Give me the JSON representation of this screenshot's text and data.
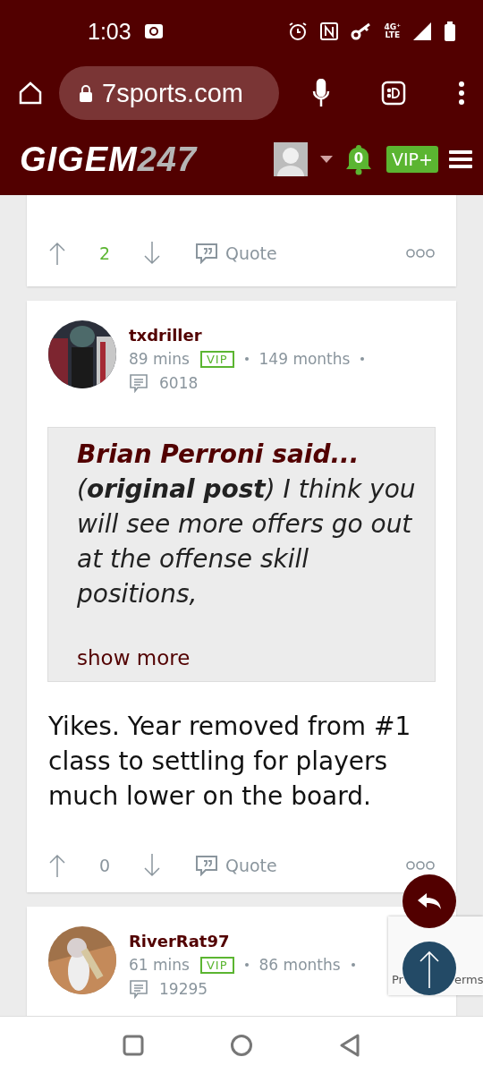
{
  "status_bar": {
    "time": "1:03",
    "network": "4G⁺\nLTE"
  },
  "browser": {
    "url": "7sports.com"
  },
  "site_header": {
    "logo": "GIGEM",
    "logo_suffix": "247",
    "notifications": "0",
    "vip_button": "VIP+"
  },
  "posts": [
    {
      "kind": "partial",
      "score": "2",
      "score_positive": true,
      "quote_label": "Quote"
    },
    {
      "kind": "full",
      "author": "txdriller",
      "age": "89 mins",
      "badge": "VIP",
      "tenure": "149 months",
      "post_count": "6018",
      "quote": {
        "author": "Brian Perroni said...",
        "text": "(**original post**) I think you will see more offers go out at the offense skill positions,",
        "more": "show more"
      },
      "body": "Yikes. Year removed from #1 class to settling for players much lower on the board.",
      "score": "0",
      "score_positive": false,
      "quote_label": "Quote"
    },
    {
      "kind": "header",
      "author": "RiverRat97",
      "age": "61 mins",
      "badge": "VIP",
      "tenure": "86 months",
      "post_count": "19295"
    }
  ],
  "recaptcha": {
    "left": "Pr",
    "right": "erms"
  }
}
